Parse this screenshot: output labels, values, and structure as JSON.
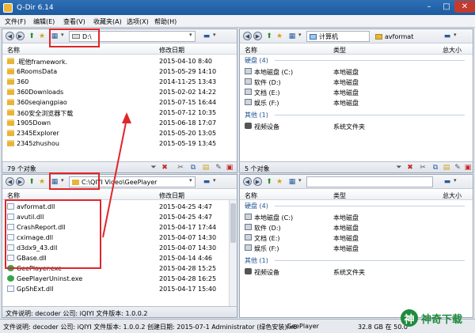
{
  "window": {
    "title": "Q-Dir 6.14",
    "min": "–",
    "max": "□",
    "close": "✕"
  },
  "menu": [
    "文件(F)",
    "编辑(E)",
    "查看(V)",
    "收藏夹(A)",
    "选项(X)",
    "帮助(H)"
  ],
  "panes": {
    "top_left": {
      "address": "D:\\",
      "columns": {
        "name": "名称",
        "date": "修改日期"
      },
      "rows": [
        {
          "name": ".昵他framework.",
          "date": "2015-04-10 8:40"
        },
        {
          "name": "6RoomsData",
          "date": "2015-05-29 14:10"
        },
        {
          "name": "360",
          "date": "2014-11-25 13:43"
        },
        {
          "name": "360Downloads",
          "date": "2015-02-02 14:22"
        },
        {
          "name": "360seqiangpiao",
          "date": "2015-07-15 16:44"
        },
        {
          "name": "360安全浏览器下载",
          "date": "2015-07-12 10:35"
        },
        {
          "name": "1905Down",
          "date": "2015-06-18 17:07"
        },
        {
          "name": "2345Explorer",
          "date": "2015-05-20 13:05"
        },
        {
          "name": "2345zhushou",
          "date": "2015-05-19 13:45"
        }
      ],
      "status": "79 个对象"
    },
    "top_right": {
      "address": "计算机",
      "address_suffix": "avformat",
      "columns": {
        "name": "名称",
        "type": "类型",
        "size": "总大小"
      },
      "groups": [
        {
          "label": "硬盘 (4)",
          "rows": [
            {
              "name": "本地磁盘 (C:)",
              "type": "本地磁盘"
            },
            {
              "name": "软件 (D:)",
              "type": "本地磁盘"
            },
            {
              "name": "文档 (E:)",
              "type": "本地磁盘"
            },
            {
              "name": "娱乐 (F:)",
              "type": "本地磁盘"
            }
          ]
        },
        {
          "label": "其他 (1)",
          "rows": [
            {
              "name": "视频设备",
              "type": "系统文件夹"
            }
          ]
        }
      ],
      "status": "5 个对象"
    },
    "bottom_left": {
      "address": "C:\\QIYI Video\\GeePlayer",
      "columns": {
        "name": "名称",
        "date": "修改日期"
      },
      "rows": [
        {
          "name": "avformat.dll",
          "date": "2015-04-25 4:47",
          "kind": "dll"
        },
        {
          "name": "avutil.dll",
          "date": "2015-04-25 4:47",
          "kind": "dll"
        },
        {
          "name": "CrashReport.dll",
          "date": "2015-04-17 17:44",
          "kind": "dll"
        },
        {
          "name": "cximage.dll",
          "date": "2015-04-07 14:30",
          "kind": "dll"
        },
        {
          "name": "d3dx9_43.dll",
          "date": "2015-04-07 14:30",
          "kind": "dll"
        },
        {
          "name": "GBase.dll",
          "date": "2015-04-14 4:46",
          "kind": "dll"
        },
        {
          "name": "GeePlayer.exe",
          "date": "2015-04-28 15:25",
          "kind": "exe"
        },
        {
          "name": "GeePlayerUninst.exe",
          "date": "2015-04-28 16:25",
          "kind": "exe"
        },
        {
          "name": "GpShExt.dll",
          "date": "2015-04-17 15:40",
          "kind": "dll"
        }
      ],
      "status": "文件说明: decoder 公司: iQIYI 文件版本: 1.0.0.2"
    },
    "bottom_right": {
      "columns": {
        "name": "名称",
        "type": "类型",
        "size": "总大小"
      },
      "groups": [
        {
          "label": "硬盘 (4)",
          "rows": [
            {
              "name": "本地磁盘 (C:)",
              "type": "本地磁盘"
            },
            {
              "name": "软件 (D:)",
              "type": "本地磁盘"
            },
            {
              "name": "文档 (E:)",
              "type": "本地磁盘"
            },
            {
              "name": "娱乐 (F:)",
              "type": "本地磁盘"
            }
          ]
        },
        {
          "label": "其他 (1)",
          "rows": [
            {
              "name": "视频设备",
              "type": "系统文件夹"
            }
          ]
        }
      ]
    }
  },
  "footer": {
    "info": "文件说明: decoder 公司: iQIYI 文件版本: 1.0.0.2 创建日期: 2015-07-1 Administrator (绿色安装)/x6",
    "path": "GeePlayer",
    "disk": "32.8 GB 在 50.0"
  },
  "brand": {
    "logo": "神",
    "text": "神奇下载"
  },
  "colors": {
    "annotation": "#e0262a",
    "titlebar": "#1d5aa0",
    "brand": "#1f8a3c"
  }
}
